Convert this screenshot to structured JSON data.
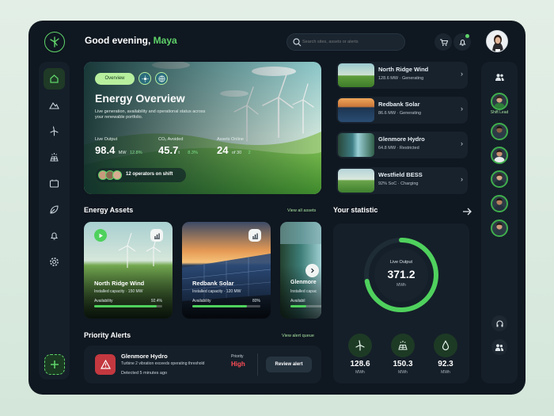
{
  "greeting": {
    "prefix": "Good evening, ",
    "name": "Maya"
  },
  "search": {
    "placeholder": "Search sites, assets or alerts"
  },
  "hero": {
    "tabs": [
      "Overview"
    ],
    "title": "Energy Overview",
    "description": "Live generation, availability and operational status across your renewable portfolio.",
    "stats": [
      {
        "label": "Live Output",
        "value": "98.4",
        "unit": "MW",
        "delta": "12.8%"
      },
      {
        "label": "CO₂ Avoided",
        "value": "45.7",
        "unit": "t",
        "delta": "8.3%"
      },
      {
        "label": "Assets Online",
        "value": "24",
        "unit": "of 30",
        "delta": "2"
      }
    ],
    "operators": "12 operators on shift"
  },
  "assets_list": [
    {
      "name": "North Ridge Wind",
      "status": "128.6 MW · Generating"
    },
    {
      "name": "Redbank Solar",
      "status": "86.6 MW · Generating"
    },
    {
      "name": "Glenmore Hydro",
      "status": "64.8 MW · Restricted"
    },
    {
      "name": "Westfield BESS",
      "status": "92% SoC · Charging"
    }
  ],
  "energy_assets": {
    "title": "Energy Assets",
    "view_all": "View all assets",
    "cards": [
      {
        "name": "North Ridge Wind",
        "capacity": "Installed capacity · 150 MW",
        "availability_label": "Availability",
        "availability": "92.4%",
        "fill": 0.924
      },
      {
        "name": "Redbank Solar",
        "capacity": "Installed capacity · 120 MW",
        "availability_label": "Availability",
        "availability": "80%",
        "fill": 0.8
      },
      {
        "name": "Glenmore",
        "capacity": "Installed capac",
        "availability_label": "Availabil",
        "availability": "",
        "fill": 0.5
      }
    ]
  },
  "priority_alerts": {
    "title": "Priority Alerts",
    "view_queue": "View alert queue",
    "alert": {
      "site": "Glenmore Hydro",
      "message": "Turbine 2 vibration exceeds operating threshold",
      "time": "Detected 5 minutes ago",
      "priority_label": "Priority",
      "priority": "High",
      "action": "Review alert"
    }
  },
  "statistic": {
    "title": "Your statistic",
    "gauge_label": "Live Output",
    "gauge_value": "371.2",
    "gauge_unit": "MWh",
    "gauge_fill": 0.72,
    "minis": [
      {
        "icon": "wind-turbine-icon",
        "value": "128.6",
        "unit": "MWh"
      },
      {
        "icon": "solar-panel-icon",
        "value": "150.3",
        "unit": "MWh"
      },
      {
        "icon": "water-drop-icon",
        "value": "92.3",
        "unit": "MWh"
      }
    ]
  },
  "team": {
    "shift_lead": "Shift Lead"
  },
  "colors": {
    "accent": "#5fd36a",
    "background": "#0f1720",
    "panel": "#151f29",
    "alert": "#c4383f"
  }
}
